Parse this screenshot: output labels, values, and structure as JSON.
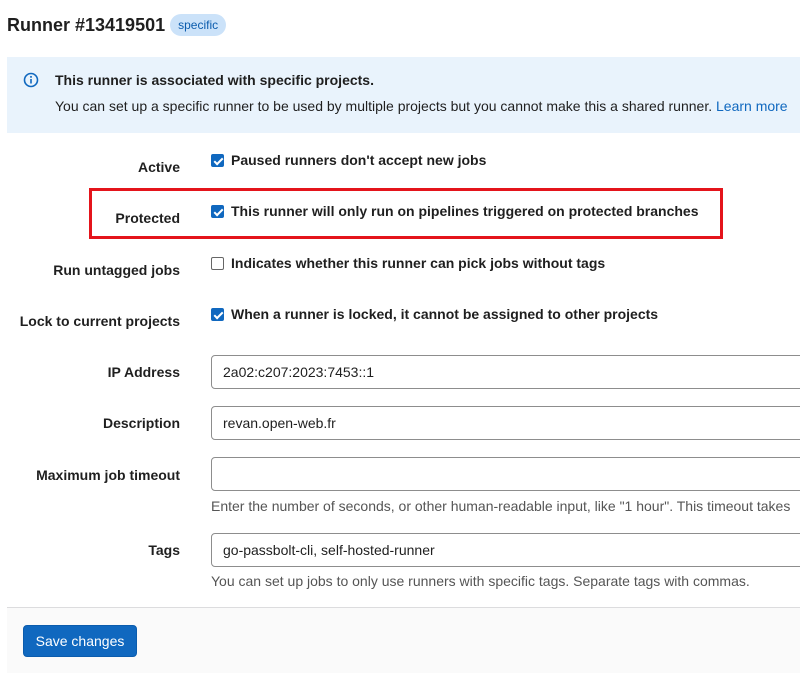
{
  "header": {
    "title": "Runner #13419501",
    "badge": "specific"
  },
  "alert": {
    "title": "This runner is associated with specific projects.",
    "body": "You can set up a specific runner to be used by multiple projects but you cannot make this a shared runner.",
    "link": "Learn more"
  },
  "settings": {
    "active": {
      "label": "Active",
      "checked": true,
      "text": "Paused runners don't accept new jobs"
    },
    "protected": {
      "label": "Protected",
      "checked": true,
      "text": "This runner will only run on pipelines triggered on protected branches"
    },
    "untagged": {
      "label": "Run untagged jobs",
      "checked": false,
      "text": "Indicates whether this runner can pick jobs without tags"
    },
    "locked": {
      "label": "Lock to current projects",
      "checked": true,
      "text": "When a runner is locked, it cannot be assigned to other projects"
    }
  },
  "fields": {
    "ip": {
      "label": "IP Address",
      "value": "2a02:c207:2023:7453::1"
    },
    "description": {
      "label": "Description",
      "value": "revan.open-web.fr"
    },
    "timeout": {
      "label": "Maximum job timeout",
      "value": "",
      "help": "Enter the number of seconds, or other human-readable input, like \"1 hour\". This timeout takes"
    },
    "tags": {
      "label": "Tags",
      "value": "go-passbolt-cli, self-hosted-runner",
      "help": "You can set up jobs to only use runners with specific tags. Separate tags with commas."
    }
  },
  "footer": {
    "save_label": "Save changes"
  },
  "colors": {
    "accent": "#1068bf",
    "alert_bg": "#e9f3fc",
    "highlight": "#e4141b"
  }
}
